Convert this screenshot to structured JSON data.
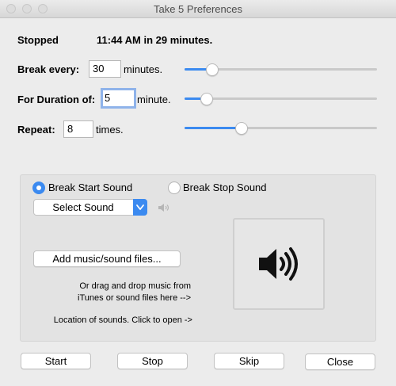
{
  "window": {
    "title": "Take 5 Preferences"
  },
  "status": {
    "state": "Stopped",
    "next": "11:44 AM in 29 minutes."
  },
  "break_every": {
    "label": "Break every:",
    "value": "30",
    "unit": "minutes.",
    "slider_fraction": 0.12
  },
  "duration": {
    "label": "For Duration of:",
    "value": "5",
    "unit": "minute.",
    "slider_fraction": 0.09
  },
  "repeat": {
    "label": "Repeat:",
    "value": "8",
    "unit": "times.",
    "slider_fraction": 0.28
  },
  "sound": {
    "start_label": "Break Start Sound",
    "stop_label": "Break Stop Sound",
    "selected": "start",
    "select_value": "Select Sound",
    "add_button": "Add music/sound files...",
    "drag_note_line1": "Or drag and drop music from",
    "drag_note_line2": "iTunes or sound files here -->",
    "location_note": "Location of sounds. Click to open ->"
  },
  "buttons": {
    "start": "Start",
    "stop": "Stop",
    "skip": "Skip",
    "close": "Close"
  },
  "colors": {
    "accent": "#3b8af0",
    "focus_ring": "#8fb3ea",
    "window_bg": "#ececec"
  },
  "icons": {
    "speaker": "speaker-icon",
    "small_speaker": "speaker-small-icon",
    "popup_arrow": "chevron-down-icon"
  }
}
